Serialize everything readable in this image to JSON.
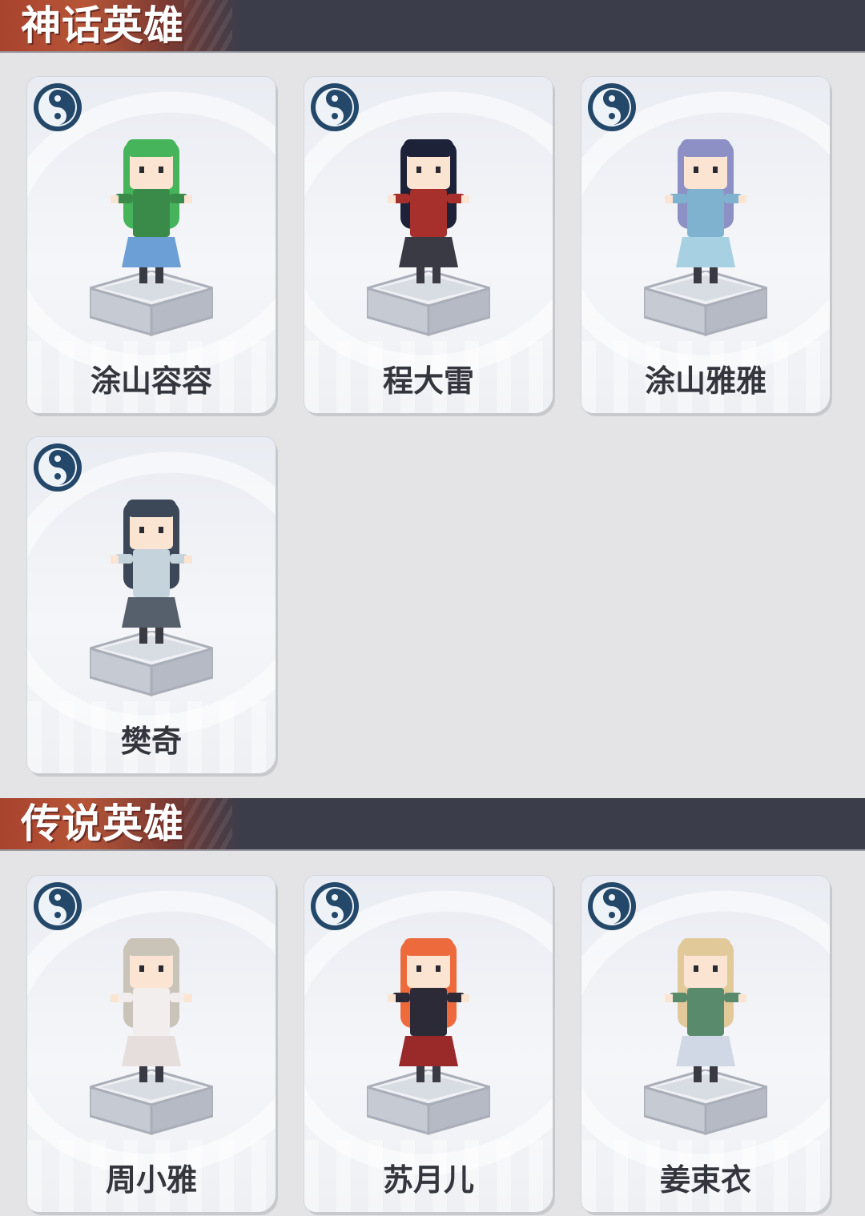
{
  "sections": [
    {
      "title": "神话英雄",
      "heroes": [
        {
          "name": "涂山容容",
          "icon": "element-swirl-icon",
          "hair": "#46b45a",
          "outfit": "#3a8a4a",
          "skirt": "#6c9fd6"
        },
        {
          "name": "程大雷",
          "icon": "element-swirl-icon",
          "hair": "#1e2238",
          "outfit": "#a8302c",
          "skirt": "#3a3a44"
        },
        {
          "name": "涂山雅雅",
          "icon": "element-swirl-icon",
          "hair": "#8c90c4",
          "outfit": "#7fb2cf",
          "skirt": "#a7d1e2"
        },
        {
          "name": "樊奇",
          "icon": "element-swirl-icon",
          "hair": "#3c4858",
          "outfit": "#c5d4dc",
          "skirt": "#56606c"
        }
      ]
    },
    {
      "title": "传说英雄",
      "heroes": [
        {
          "name": "周小雅",
          "icon": "element-swirl-icon",
          "hair": "#c9c3b8",
          "outfit": "#f2eeee",
          "skirt": "#e6dedc"
        },
        {
          "name": "苏月儿",
          "icon": "element-swirl-icon",
          "hair": "#ec6a3c",
          "outfit": "#2c2a36",
          "skirt": "#9a2a2a"
        },
        {
          "name": "姜束衣",
          "icon": "element-swirl-icon",
          "hair": "#e2c99a",
          "outfit": "#5a8a6c",
          "skirt": "#cfd8e4"
        }
      ]
    }
  ]
}
